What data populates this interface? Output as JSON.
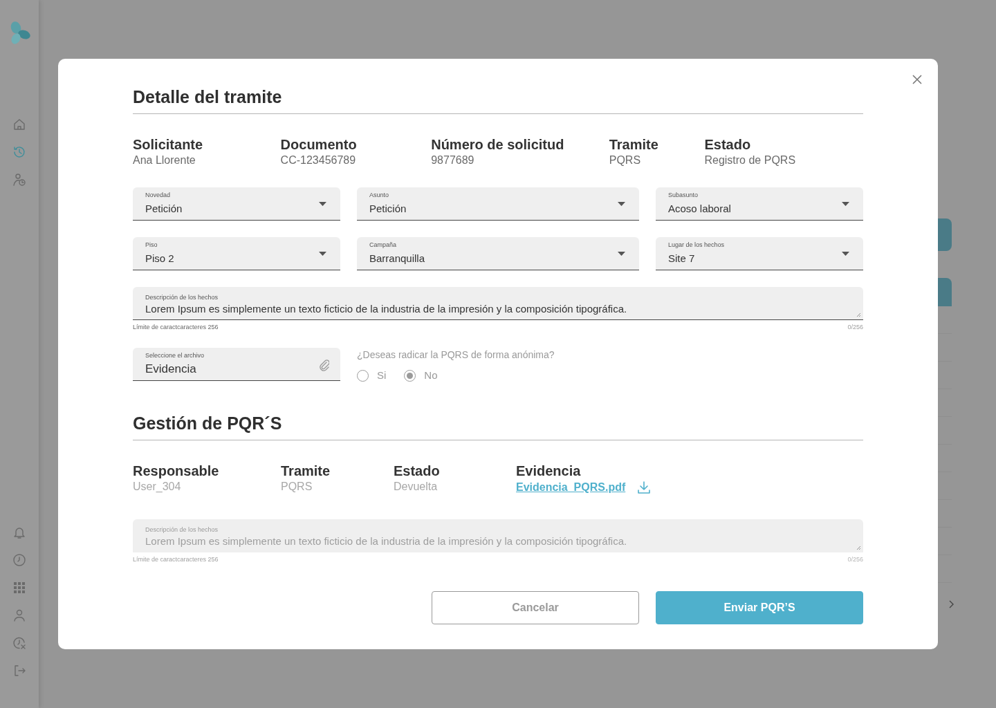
{
  "sidebar": {
    "top_items": [
      {
        "selected": false
      },
      {
        "selected": true
      },
      {
        "selected": false
      }
    ],
    "bottom_items": [
      {
        "selected": false
      },
      {
        "selected": false
      },
      {
        "selected": false
      },
      {
        "selected": false
      },
      {
        "selected": false
      },
      {
        "selected": false
      }
    ]
  },
  "modal": {
    "title": "Detalle del tramite",
    "details": [
      {
        "label": "Solicitante",
        "value": "Ana Llorente"
      },
      {
        "label": "Documento",
        "value": "CC-123456789"
      },
      {
        "label": "Número de solicitud",
        "value": "9877689"
      },
      {
        "label": "Tramite",
        "value": "PQRS"
      },
      {
        "label": "Estado",
        "value": "Registro de PQRS"
      }
    ],
    "fields": [
      {
        "label": "Novedad",
        "value": "Petición"
      },
      {
        "label": "Asunto",
        "value": "Petición"
      },
      {
        "label": "Subasunto",
        "value": "Acoso laboral"
      },
      {
        "label": "Piso",
        "value": "Piso 2"
      },
      {
        "label": "Campaña",
        "value": "Barranquilla"
      },
      {
        "label": "Lugar de los hechos",
        "value": "Site 7"
      }
    ],
    "description": {
      "label": "Descripción de los hechos",
      "value": "Lorem Ipsum es simplemente un texto ficticio de la industria de la impresión y la composición tipográfica.",
      "helper": "Límite de caractcaracteres 256",
      "counter": "0/256",
      "disabled": false
    },
    "file_field": {
      "label": "Seleccione el archivo",
      "value": "Evidencia"
    },
    "anonymous": {
      "question": "¿Deseas radicar la PQRS de forma anónima?",
      "options": [
        {
          "label": "Si",
          "selected": false
        },
        {
          "label": "No",
          "selected": true
        }
      ]
    },
    "section_title": "Gestión de PQR´S",
    "management": [
      {
        "label": "Responsable",
        "value": "User_304",
        "kind": "text"
      },
      {
        "label": "Tramite",
        "value": "PQRS",
        "kind": "text"
      },
      {
        "label": "Estado",
        "value": "Devuelta",
        "kind": "text"
      },
      {
        "label": "Evidencia",
        "value": "Evidencia_PQRS.pdf",
        "kind": "link"
      }
    ],
    "management_description": {
      "label": "Descripción de los hechos",
      "value": "Lorem Ipsum es simplemente un texto ficticio de la industria de la impresión y la composición tipográfica.",
      "helper": "Límite de caractcaracteres 256",
      "counter": "0/256",
      "disabled": true
    },
    "buttons": [
      {
        "label": "Cancelar",
        "kind": "secondary"
      },
      {
        "label": "Enviar PQR’S",
        "kind": "primary"
      }
    ]
  }
}
